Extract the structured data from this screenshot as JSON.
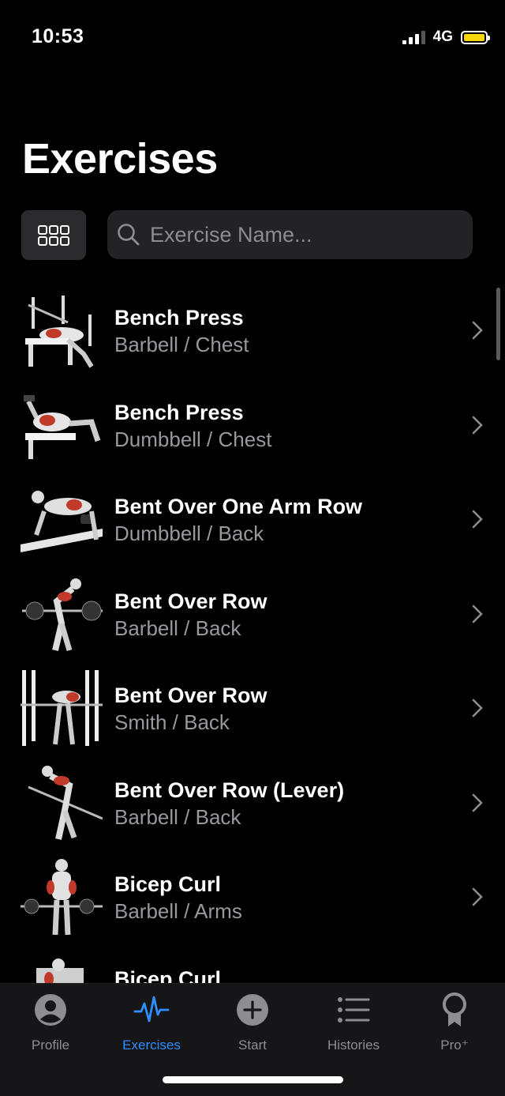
{
  "status_bar": {
    "time": "10:53",
    "network": "4G",
    "battery_color": "#f5d50b"
  },
  "header": {
    "title": "Exercises"
  },
  "search": {
    "placeholder": "Exercise Name..."
  },
  "exercises": [
    {
      "name": "Bench Press",
      "detail": "Barbell / Chest"
    },
    {
      "name": "Bench Press",
      "detail": "Dumbbell / Chest"
    },
    {
      "name": "Bent Over One Arm Row",
      "detail": "Dumbbell / Back"
    },
    {
      "name": "Bent Over Row",
      "detail": "Barbell / Back"
    },
    {
      "name": "Bent Over Row",
      "detail": "Smith / Back"
    },
    {
      "name": "Bent Over Row (Lever)",
      "detail": "Barbell / Back"
    },
    {
      "name": "Bicep Curl",
      "detail": "Barbell / Arms"
    },
    {
      "name": "Bicep Curl",
      "detail": ""
    }
  ],
  "tabbar": {
    "tabs": [
      {
        "label": "Profile",
        "icon": "person-circle-icon"
      },
      {
        "label": "Exercises",
        "icon": "pulse-icon",
        "active": true
      },
      {
        "label": "Start",
        "icon": "plus-circle-icon"
      },
      {
        "label": "Histories",
        "icon": "list-icon"
      },
      {
        "label": "Pro⁺",
        "icon": "award-ribbon-icon"
      }
    ]
  },
  "colors": {
    "accent": "#2f8fff",
    "muscle_highlight": "#c0392b"
  }
}
